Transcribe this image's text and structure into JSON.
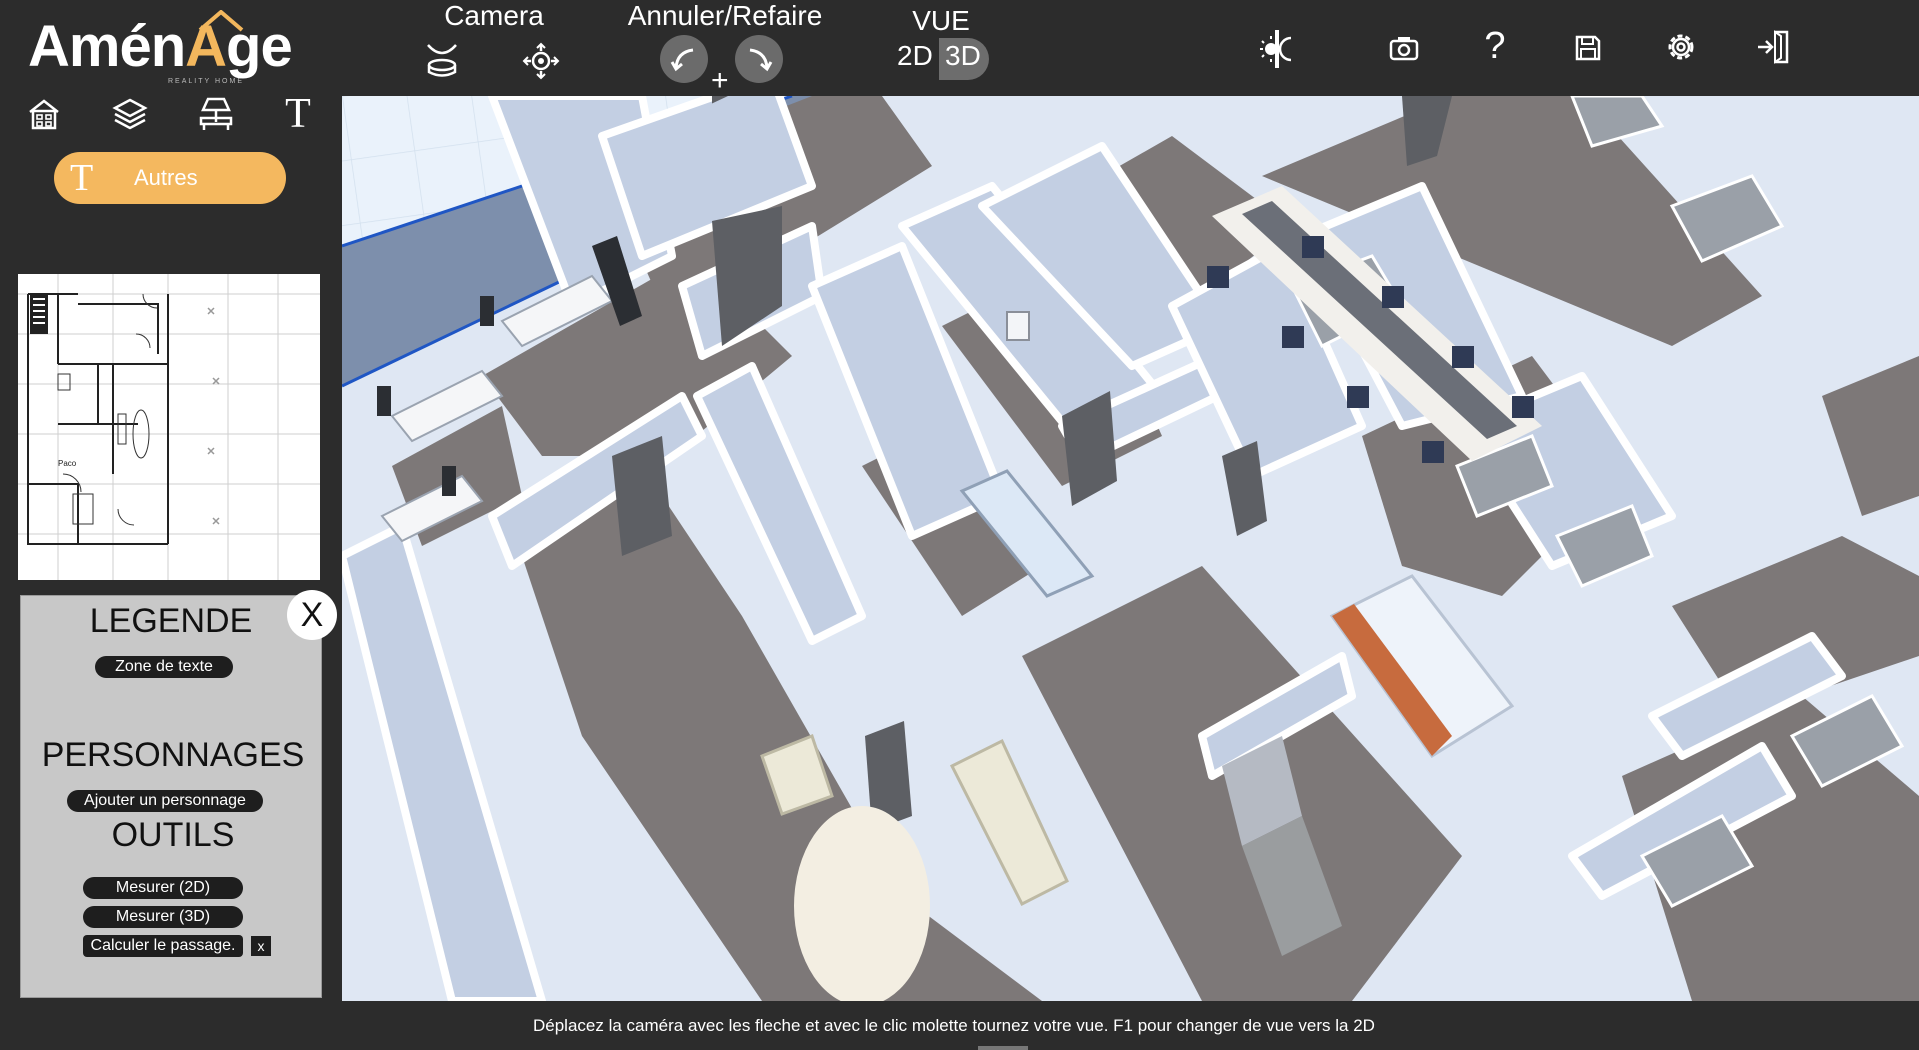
{
  "app": {
    "logo_part1": "Amén",
    "logo_accent": "A",
    "logo_part2": "ge",
    "logo_tagline": "REALITY HOME",
    "brand_color": "#f3b75d"
  },
  "toolbar": {
    "camera_label": "Camera",
    "undo_redo_label": "Annuler/Refaire",
    "undo_redo_plus": "+",
    "view_label": "VUE",
    "view_2d": "2D",
    "view_3d": "3D",
    "view_active": "3D",
    "icons": [
      "camera-top-view-icon",
      "camera-orbit-icon",
      "undo-icon",
      "redo-icon",
      "day-night-icon",
      "screenshot-icon",
      "help-icon",
      "save-icon",
      "settings-icon",
      "exit-icon"
    ],
    "help_glyph": "?"
  },
  "left_tools": {
    "icons": [
      "house-icon",
      "layers-icon",
      "furniture-lamp-icon",
      "text-icon"
    ],
    "text_glyph": "T",
    "active_category": {
      "icon_glyph": "T",
      "label": "Autres"
    }
  },
  "legend_panel": {
    "close_label": "X",
    "legende_title": "LEGENDE",
    "zone_texte_button": "Zone de texte",
    "personnages_title": "PERSONNAGES",
    "add_character_button": "Ajouter un personnage",
    "outils_title": "OUTILS",
    "measure_2d_button": "Mesurer (2D)",
    "measure_3d_button": "Mesurer (3D)",
    "calc_passage_button": "Calculer le passage.",
    "calc_passage_clear": "x"
  },
  "minimap": {
    "room_label": "Paco"
  },
  "status_bar": {
    "hint": "Déplacez la caméra avec les fleche et avec le clic molette tournez votre vue. F1 pour changer de vue vers la 2D"
  },
  "colors": {
    "background": "#2c2c2c",
    "panel": "#c8c8c8",
    "accent": "#f4b85f",
    "floor": "#7d7878",
    "wall_top": "#ffffff",
    "wall_side": "#c2d0e6",
    "ground": "#eaf2fb"
  }
}
